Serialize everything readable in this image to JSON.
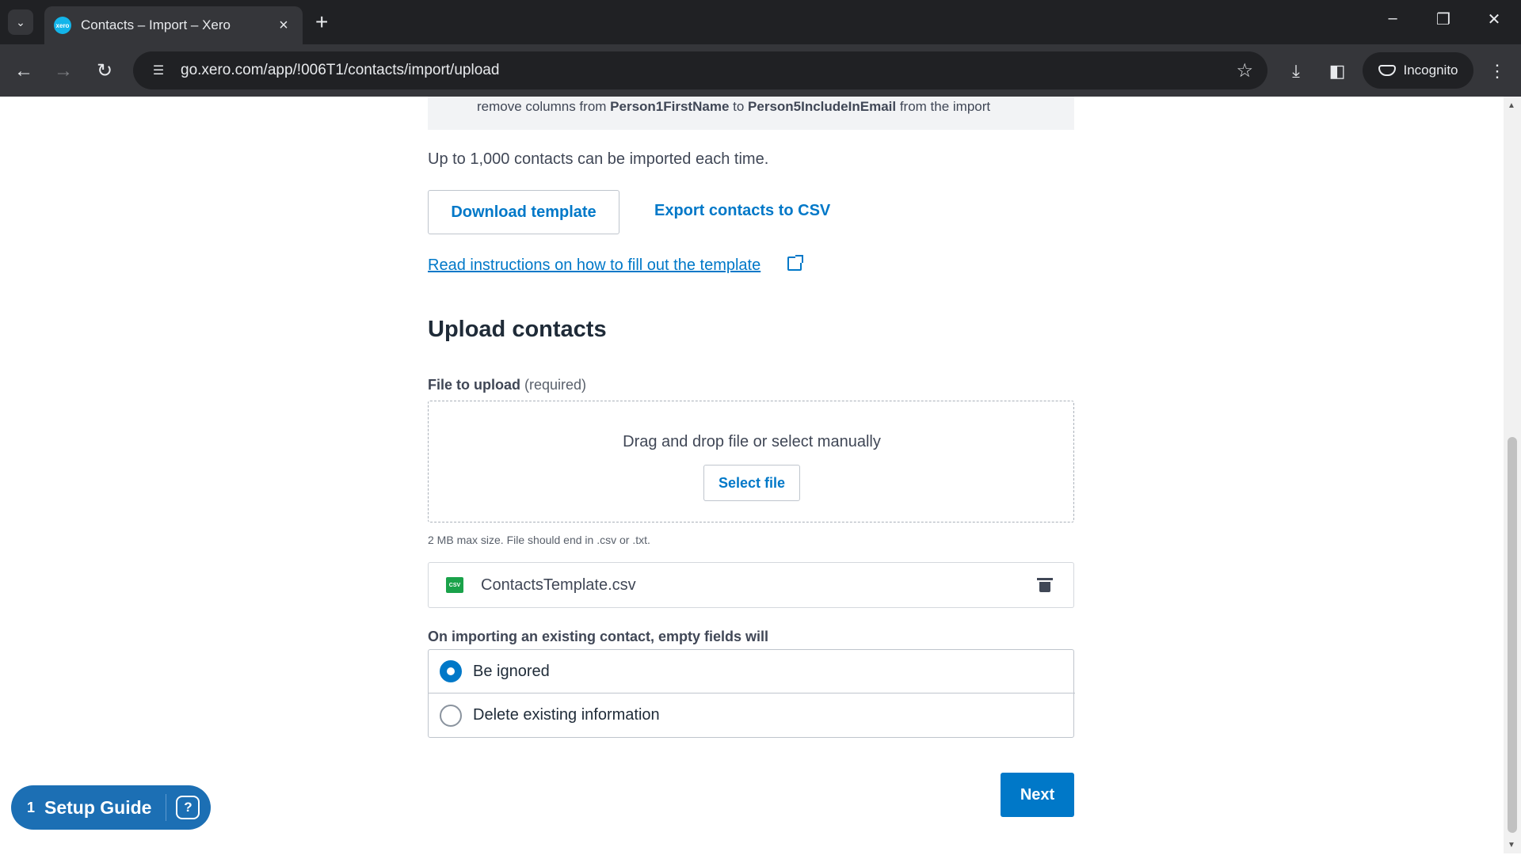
{
  "browser": {
    "tab_title": "Contacts – Import – Xero",
    "tab_favicon_text": "xero",
    "url": "go.xero.com/app/!006T1/contacts/import/upload",
    "incognito_label": "Incognito",
    "icons": {
      "tab_search": "chevron-down-icon",
      "close": "close-icon",
      "new_tab": "plus-icon",
      "back": "back-arrow-icon",
      "forward": "forward-arrow-icon",
      "reload": "reload-icon",
      "site_info": "tune-icon",
      "bookmark": "star-icon",
      "download": "download-icon",
      "side_panel": "side-panel-icon",
      "menu": "kebab-menu-icon"
    }
  },
  "page": {
    "note": {
      "prefix": "remove columns from ",
      "from_field": "Person1FirstName",
      "middle": " to ",
      "to_field": "Person5IncludeInEmail",
      "suffix": " from the import"
    },
    "limit_text": "Up to 1,000 contacts can be imported each time.",
    "download_template_label": "Download template",
    "export_csv_label": "Export contacts to CSV",
    "instructions_link": "Read instructions on how to fill out the template",
    "upload_heading": "Upload contacts",
    "file_label": "File to upload",
    "file_label_required": "(required)",
    "drop_text": "Drag and drop file or select manually",
    "select_file_label": "Select file",
    "file_hint": "2 MB max size. File should end in .csv or .txt.",
    "uploaded_file": {
      "name": "ContactsTemplate.csv",
      "type_badge": "CSV"
    },
    "radio_question": "On importing an existing contact, empty fields will",
    "radio_options": [
      {
        "label": "Be ignored",
        "checked": true
      },
      {
        "label": "Delete existing information",
        "checked": false
      }
    ],
    "next_label": "Next"
  },
  "setup_guide": {
    "count": "1",
    "label": "Setup Guide"
  },
  "colors": {
    "accent": "#0078c8",
    "setup_guide": "#1c6fb4",
    "csv_badge": "#1aa24a"
  }
}
